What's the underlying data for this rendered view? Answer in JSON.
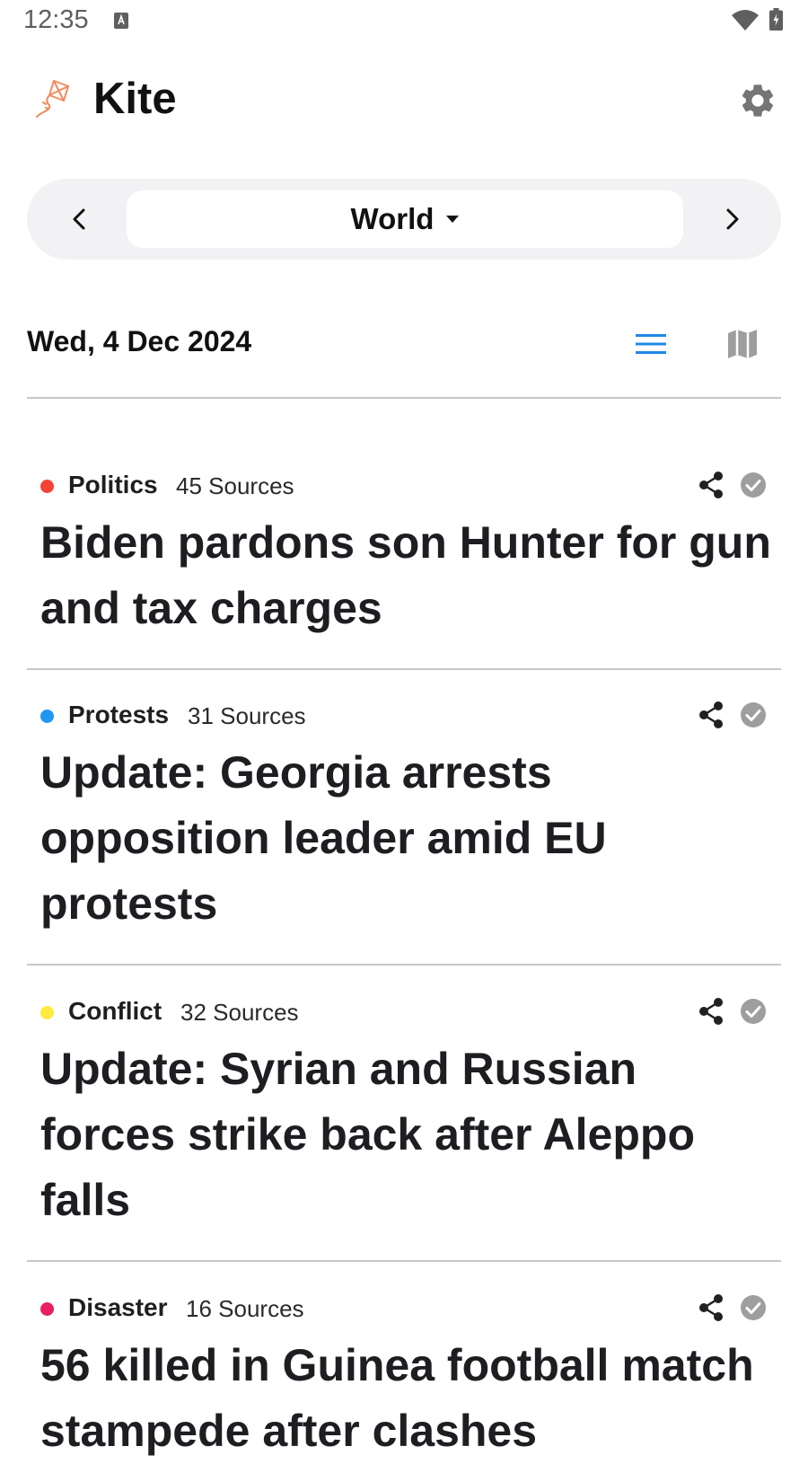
{
  "status_bar": {
    "time": "12:35",
    "icons": [
      "text-notification-icon",
      "wifi-icon",
      "battery-charging-icon"
    ]
  },
  "header": {
    "app_name": "Kite",
    "logo_icon": "kite-icon",
    "logo_color": "#f08a5d",
    "settings_icon": "gear-icon"
  },
  "region": {
    "selected": "World",
    "prev_icon": "chevron-left-icon",
    "next_icon": "chevron-right-icon",
    "dropdown_icon": "caret-down-icon"
  },
  "date_row": {
    "date": "Wed, 4 Dec 2024",
    "list_view_icon": "list-view-icon",
    "map_view_icon": "map-icon",
    "active_view_color": "#1e88e5"
  },
  "stories": [
    {
      "category": "Politics",
      "category_color": "#f44336",
      "sources": "45 Sources",
      "title": "Biden pardons son Hunter for gun and tax charges"
    },
    {
      "category": "Protests",
      "category_color": "#2196f3",
      "sources": "31 Sources",
      "title": "Update: Georgia arrests opposition leader amid EU protests"
    },
    {
      "category": "Conflict",
      "category_color": "#ffeb3b",
      "sources": "32 Sources",
      "title": "Update: Syrian and Russian forces strike back after Aleppo falls"
    },
    {
      "category": "Disaster",
      "category_color": "#e91e63",
      "sources": "16 Sources",
      "title": "56 killed in Guinea football match stampede after clashes"
    }
  ]
}
